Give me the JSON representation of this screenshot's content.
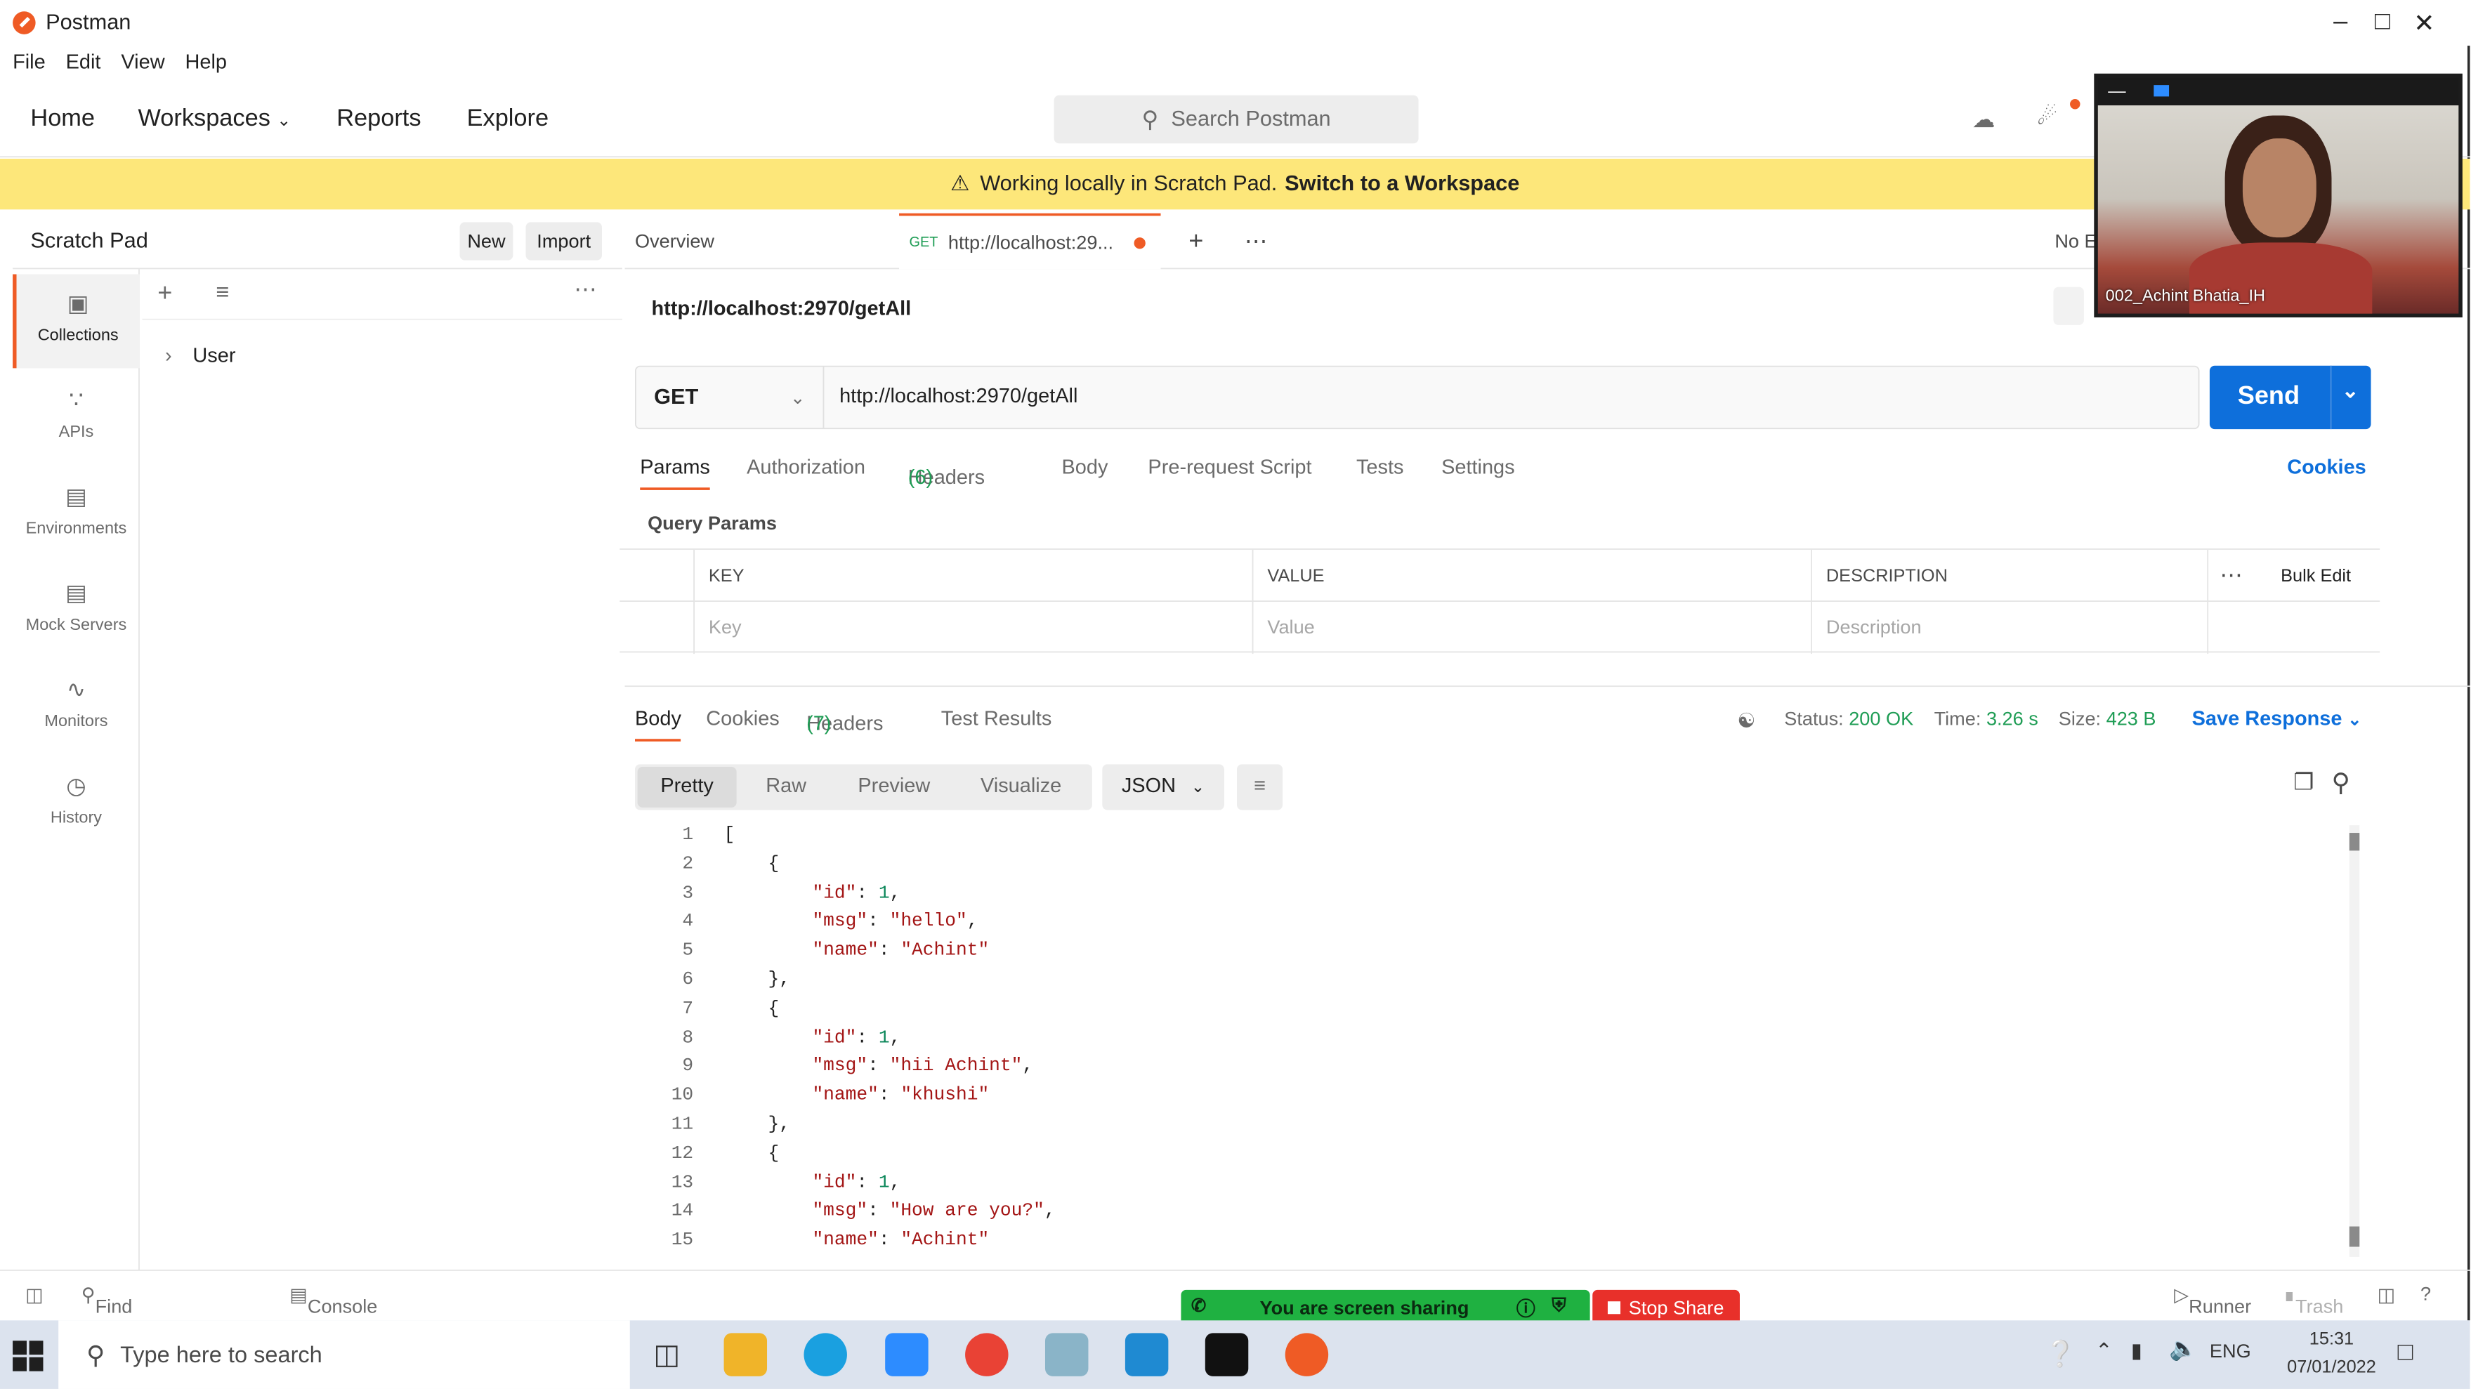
{
  "window": {
    "title": "Postman"
  },
  "menu": [
    "File",
    "Edit",
    "View",
    "Help"
  ],
  "nav": {
    "home": "Home",
    "workspaces": "Workspaces",
    "reports": "Reports",
    "explore": "Explore",
    "search_placeholder": "Search Postman"
  },
  "banner": {
    "text": "Working locally in Scratch Pad.",
    "link": "Switch to a Workspace"
  },
  "sidebar": {
    "title": "Scratch Pad",
    "new_label": "New",
    "import_label": "Import",
    "rail": [
      "Collections",
      "APIs",
      "Environments",
      "Mock Servers",
      "Monitors",
      "History"
    ],
    "tree": [
      {
        "label": "User"
      }
    ]
  },
  "tabs": {
    "overview": "Overview",
    "active_method": "GET",
    "active_label": "http://localhost:29...",
    "env": "No E"
  },
  "request": {
    "path": "http://localhost:2970/getAll",
    "method": "GET",
    "url": "http://localhost:2970/getAll",
    "send_label": "Send",
    "tabs": [
      "Params",
      "Authorization",
      "Headers",
      "Body",
      "Pre-request Script",
      "Tests",
      "Settings"
    ],
    "headers_count": "(6)",
    "cookies_label": "Cookies",
    "query_params_label": "Query Params",
    "params_table": {
      "headers": [
        "KEY",
        "VALUE",
        "DESCRIPTION"
      ],
      "bulk_edit": "Bulk Edit",
      "placeholders": [
        "Key",
        "Value",
        "Description"
      ]
    }
  },
  "response": {
    "tabs": [
      "Body",
      "Cookies",
      "Headers",
      "Test Results"
    ],
    "headers_count": "(7)",
    "status_label": "Status:",
    "status_value": "200 OK",
    "time_label": "Time:",
    "time_value": "3.26 s",
    "size_label": "Size:",
    "size_value": "423 B",
    "save_label": "Save Response",
    "views": [
      "Pretty",
      "Raw",
      "Preview",
      "Visualize"
    ],
    "format": "JSON",
    "body_lines": [
      {
        "n": "1",
        "t": "["
      },
      {
        "n": "2",
        "t": "    {"
      },
      {
        "n": "3",
        "t": "        \"id\": 1,"
      },
      {
        "n": "4",
        "t": "        \"msg\": \"hello\","
      },
      {
        "n": "5",
        "t": "        \"name\": \"Achint\""
      },
      {
        "n": "6",
        "t": "    },"
      },
      {
        "n": "7",
        "t": "    {"
      },
      {
        "n": "8",
        "t": "        \"id\": 1,"
      },
      {
        "n": "9",
        "t": "        \"msg\": \"hii Achint\","
      },
      {
        "n": "10",
        "t": "        \"name\": \"khushi\""
      },
      {
        "n": "11",
        "t": "    },"
      },
      {
        "n": "12",
        "t": "    {"
      },
      {
        "n": "13",
        "t": "        \"id\": 1,"
      },
      {
        "n": "14",
        "t": "        \"msg\": \"How are you?\","
      },
      {
        "n": "15",
        "t": "        \"name\": \"Achint\""
      }
    ]
  },
  "footer": {
    "find_replace": "Find and Replace",
    "console": "Console",
    "runner": "Runner",
    "trash": "Trash"
  },
  "share": {
    "status": "You are screen sharing",
    "stop": "Stop Share"
  },
  "webcam": {
    "name": "002_Achint Bhatia_IH"
  },
  "taskbar": {
    "search_placeholder": "Type here to search",
    "lang": "ENG",
    "time": "15:31",
    "date": "07/01/2022"
  },
  "colors": {
    "accent": "#ef5b25",
    "send": "#0e6fdb",
    "banner": "#fde77a",
    "ok": "#1f9d55",
    "share": "#1fb141",
    "stop": "#e8302a"
  }
}
